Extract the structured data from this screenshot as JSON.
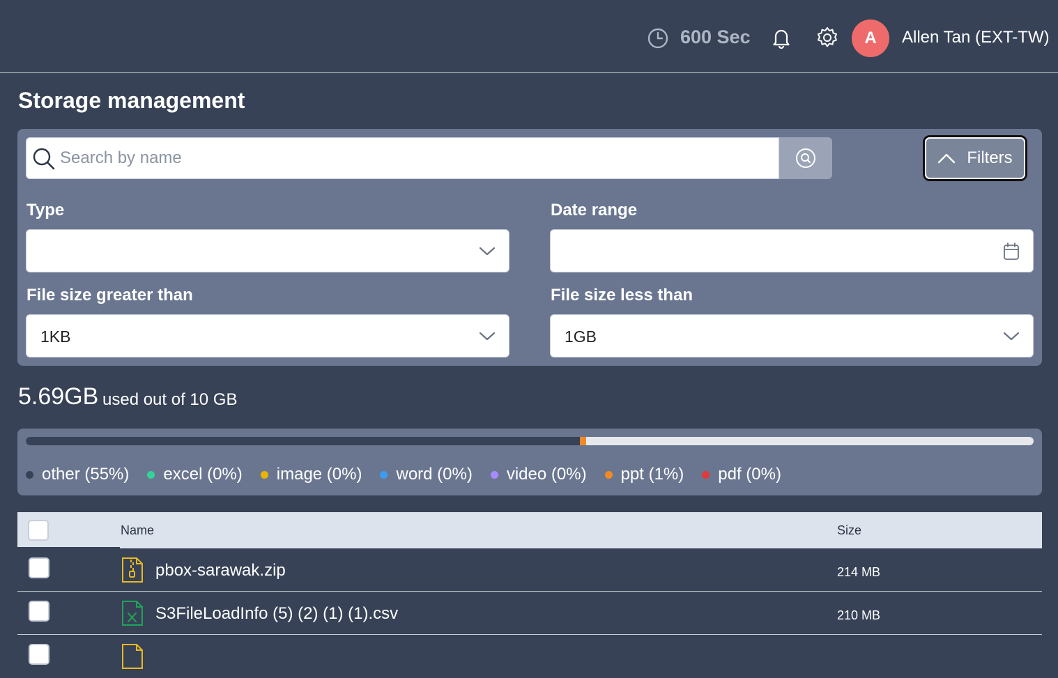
{
  "header": {
    "timer_text": "600 Sec",
    "avatar_initial": "A",
    "user_name": "Allen Tan (EXT-TW)"
  },
  "page": {
    "title": "Storage management"
  },
  "search": {
    "placeholder": "Search by name",
    "value": ""
  },
  "filters_button": {
    "label": "Filters",
    "expanded": true
  },
  "filters": {
    "type": {
      "label": "Type",
      "value": ""
    },
    "date_range": {
      "label": "Date range",
      "value": ""
    },
    "size_greater": {
      "label": "File size greater than",
      "value": "1KB"
    },
    "size_less": {
      "label": "File size less than",
      "value": "1GB"
    }
  },
  "usage": {
    "used": "5.69GB",
    "of_text": "used out of 10 GB",
    "fractions": {
      "other": 0.55,
      "ppt": 0.006
    },
    "legend": [
      {
        "label": "other (55%)",
        "color": "#374256"
      },
      {
        "label": "excel (0%)",
        "color": "#34d399"
      },
      {
        "label": "image (0%)",
        "color": "#eab308"
      },
      {
        "label": "word (0%)",
        "color": "#3b9cf0"
      },
      {
        "label": "video (0%)",
        "color": "#a78bfa"
      },
      {
        "label": "ppt (1%)",
        "color": "#f08a24"
      },
      {
        "label": "pdf (0%)",
        "color": "#e03b3b"
      }
    ]
  },
  "table": {
    "columns": {
      "name": "Name",
      "size": "Size"
    },
    "rows": [
      {
        "name": "pbox-sarawak.zip",
        "size": "214 MB",
        "icon": "zip-file-icon"
      },
      {
        "name": "S3FileLoadInfo (5) (2) (1) (1).csv",
        "size": "210 MB",
        "icon": "excel-file-icon"
      }
    ]
  },
  "colors": {
    "background": "#374256",
    "panel": "#6a7690",
    "avatar": "#ef6b6b",
    "table_header": "#dde3ec"
  }
}
